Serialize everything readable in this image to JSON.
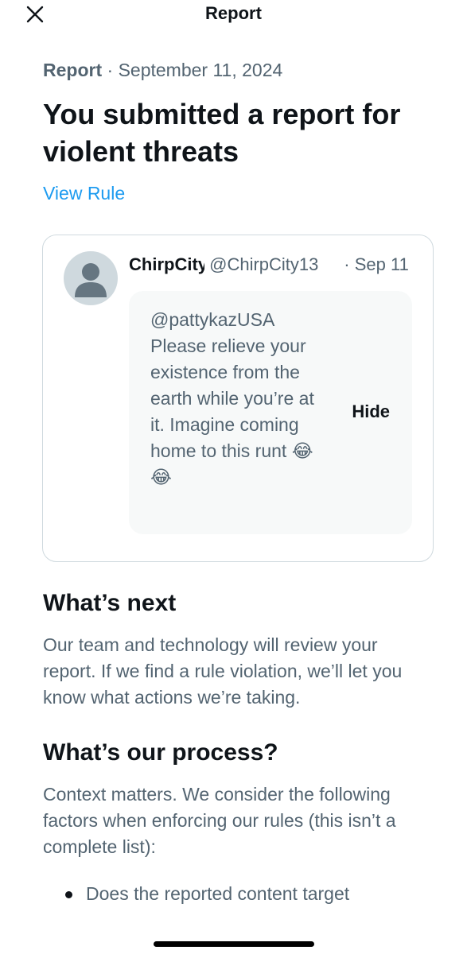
{
  "header": {
    "title": "Report",
    "close_icon": "close-icon"
  },
  "report": {
    "label": "Report",
    "separator": "·",
    "date": "September 11, 2024",
    "headline": "You submitted a report for violent threats",
    "view_rule_link": "View Rule"
  },
  "post": {
    "display_name": "ChirpCity",
    "handle": "@ChirpCity13",
    "separator": "·",
    "date": "Sep 11",
    "text": "@pattykazUSA Please relieve your existence from the earth while you’re at it. Imagine coming home to this runt 😂😂",
    "hide_label": "Hide"
  },
  "whats_next": {
    "title": "What’s next",
    "body": "Our team and technology will review your report. If we find a rule violation, we’ll let you know what actions we’re taking."
  },
  "process": {
    "title": "What’s our process?",
    "body": "Context matters. We consider the following factors when enforcing our rules (this isn’t a complete list):",
    "bullets": [
      "Does the reported content target"
    ]
  },
  "colors": {
    "text_primary": "#0f1419",
    "text_secondary": "#536471",
    "link": "#1d9bf0",
    "border": "#cfd9de",
    "quote_background": "#f7f9f9"
  }
}
